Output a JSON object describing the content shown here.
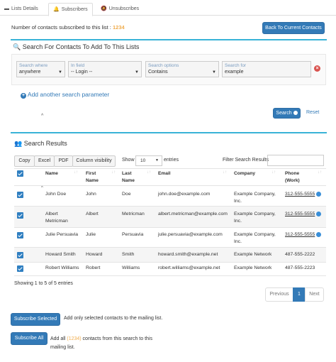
{
  "tabs": [
    {
      "label": "Lists Details",
      "icon": "list-icon"
    },
    {
      "label": "Subscribers",
      "icon": "bell-icon"
    },
    {
      "label": "Unsubscribes",
      "icon": "bell-slash-icon"
    }
  ],
  "subscribed_prefix": "Number of contacts subscribed to this list : ",
  "subscribed_count": "1234",
  "back_button": "Back To Current Contacts",
  "search_panel": {
    "title": "Search For Contacts To Add To This Lists",
    "search_where_label": "Search where",
    "search_where_value": "anywhere",
    "in_field_label": "In field",
    "in_field_value": "-- Login --",
    "search_options_label": "Search options",
    "search_options_value": "Contains",
    "search_for_label": "Search for",
    "search_for_value": "example",
    "add_param": "Add another search parameter",
    "search_button": "Search",
    "reset_button": "Reset"
  },
  "results": {
    "title": "Search Results",
    "export_buttons": [
      "Copy",
      "Excel",
      "PDF",
      "Column visibility"
    ],
    "show_label": "Show",
    "show_value": "10",
    "entries_label": "entries",
    "filter_label": "Filter Search Results",
    "filter_value": "",
    "columns": [
      "Name",
      "First Name",
      "Last Name",
      "Email",
      "Company",
      "Phone (Work)"
    ],
    "rows": [
      {
        "name": "John Doe",
        "first": "John",
        "last": "Doe",
        "email": "john.doe@example.com",
        "company": "Example Company, Inc.",
        "phone": "312-555-5555",
        "phone_link": true
      },
      {
        "name": "Albert Metricman",
        "first": "Albert",
        "last": "Metricman",
        "email": "albert.metricman@example.com",
        "company": "Example Company, Inc.",
        "phone": "312-555-5555",
        "phone_link": true
      },
      {
        "name": "Julie Persuavia",
        "first": "Julie",
        "last": "Persuavia",
        "email": "julie.persuavia@example.com",
        "company": "Example Company, Inc.",
        "phone": "312-555-5555",
        "phone_link": true
      },
      {
        "name": "Howard Smith",
        "first": "Howard",
        "last": "Smith",
        "email": "howard.smith@example.net",
        "company": "Example Network",
        "phone": "487-555-2222",
        "phone_link": false
      },
      {
        "name": "Robert Williams",
        "first": "Robert",
        "last": "Williams",
        "email": "robert.williams@example.net",
        "company": "Example Network",
        "phone": "487-555-2223",
        "phone_link": false
      }
    ],
    "showing": "Showing 1 to 5 of 5 entries",
    "pagination": {
      "previous": "Previous",
      "current": "1",
      "next": "Next"
    }
  },
  "subscribe_selected": {
    "button": "Subscribe Selected",
    "text": "Add only selected contacts to the mailing list."
  },
  "subscribe_all": {
    "button": "Subscribe All",
    "text_prefix": "Add all",
    "count": "(1234)",
    "text_suffix": "contacts from this search to this mailing list."
  },
  "colors": {
    "primary": "#337ab7",
    "accent_line": "#39b3d7",
    "count_orange": "#f0ad4e",
    "remove_red": "#d9534f"
  }
}
